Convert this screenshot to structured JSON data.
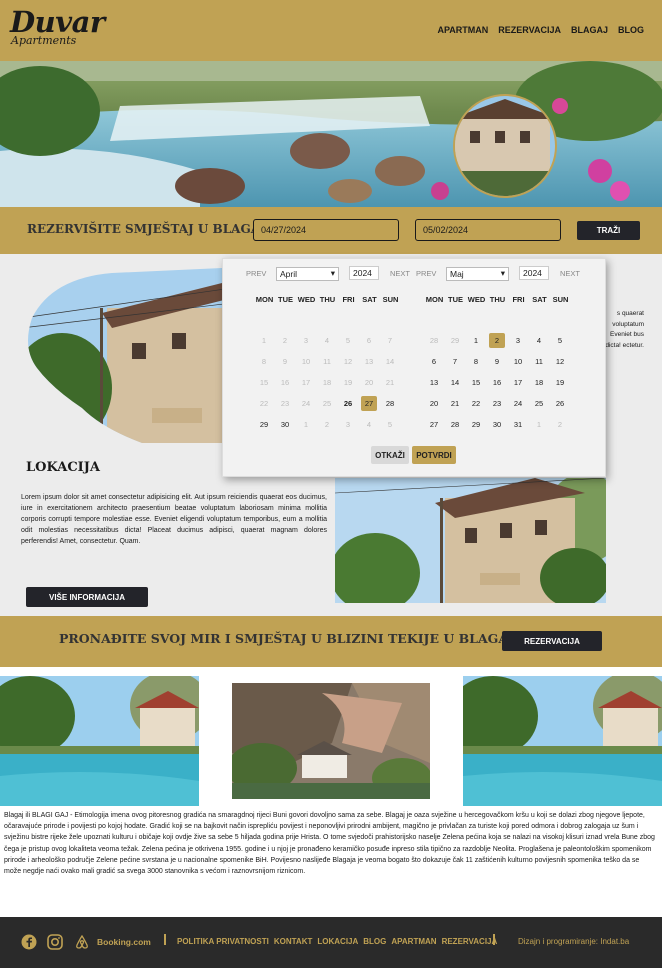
{
  "header": {
    "logo": "Duvar",
    "logo_sub": "Apartments",
    "nav": [
      "APARTMAN",
      "REZERVACIJA",
      "BLAGAJ",
      "BLOG"
    ]
  },
  "booking": {
    "title": "REZERVIŠITE SMJEŠTAJ U BLAGAJU",
    "check_in": "04/27/2024",
    "check_out": "05/02/2024",
    "search_label": "TRAŽI"
  },
  "calendar": {
    "prev_label": "PREV",
    "next_label": "NEXT",
    "weekdays": [
      "MON",
      "TUE",
      "WED",
      "THU",
      "FRI",
      "SAT",
      "SUN"
    ],
    "cancel_label": "OTKAŽI",
    "confirm_label": "POTVRDI",
    "months": [
      {
        "name": "April",
        "year": "2024",
        "weeks": [
          [
            "1",
            "2",
            "3",
            "4",
            "5",
            "6",
            "7"
          ],
          [
            "8",
            "9",
            "10",
            "11",
            "12",
            "13",
            "14"
          ],
          [
            "15",
            "16",
            "17",
            "18",
            "19",
            "20",
            "21"
          ],
          [
            "22",
            "23",
            "24",
            "25",
            "26",
            "27",
            "28"
          ],
          [
            "29",
            "30",
            "1",
            "2",
            "3",
            "4",
            "5"
          ]
        ],
        "style": [
          [
            "o",
            "o",
            "o",
            "o",
            "o",
            "o",
            "o"
          ],
          [
            "o",
            "o",
            "o",
            "o",
            "o",
            "o",
            "o"
          ],
          [
            "o",
            "o",
            "o",
            "o",
            "o",
            "o",
            "o"
          ],
          [
            "o",
            "o",
            "o",
            "o",
            "today",
            "sel",
            "n"
          ],
          [
            "n",
            "n",
            "o",
            "o",
            "o",
            "o",
            "o"
          ]
        ]
      },
      {
        "name": "Maj",
        "year": "2024",
        "weeks": [
          [
            "28",
            "29",
            "1",
            "2",
            "3",
            "4",
            "5"
          ],
          [
            "6",
            "7",
            "8",
            "9",
            "10",
            "11",
            "12"
          ],
          [
            "13",
            "14",
            "15",
            "16",
            "17",
            "18",
            "19"
          ],
          [
            "20",
            "21",
            "22",
            "23",
            "24",
            "25",
            "26"
          ],
          [
            "27",
            "28",
            "29",
            "30",
            "31",
            "1",
            "2"
          ]
        ],
        "style": [
          [
            "o",
            "o",
            "n",
            "sel",
            "n",
            "n",
            "n"
          ],
          [
            "n",
            "n",
            "n",
            "n",
            "n",
            "n",
            "n"
          ],
          [
            "n",
            "n",
            "n",
            "n",
            "n",
            "n",
            "n"
          ],
          [
            "n",
            "n",
            "n",
            "n",
            "n",
            "n",
            "n"
          ],
          [
            "n",
            "n",
            "n",
            "n",
            "n",
            "o",
            "o"
          ]
        ]
      }
    ]
  },
  "location": {
    "title": "LOKACIJA",
    "text": "Lorem ipsum dolor sit amet consectetur adipisicing elit. Aut ipsum reiciendis quaerat eos ducimus, iure in exercitationem architecto praesentium beatae voluptatum laboriosam minima mollitia corporis corrupti tempore molestiae esse. Eveniet eligendi voluptatum temporibus, eum a mollitia odit molestias necessitatibus dicta! Placeat ducimus adipisci, quaerat magnam dolores perferendis! Amet, consectetur. Quam.",
    "more_label": "VIŠE INFORMACIJA",
    "right_text": "s quaerat voluptatum Eveniet bus dicta! ectetur."
  },
  "banner": {
    "title": "PRONAĐITE SVOJ MIR I SMJEŠTAJ U BLIZINI TEKIJE U BLAGAJU",
    "button": "REZERVACIJA"
  },
  "description": "Blagaj ili BLAGI GAJ - Etimologija imena ovog pitoresnog gradića na smaragdnoj rijeci Buni govori dovoljno sama za sebe. Blagaj je oaza svježine u hercegovačkom kršu u koji se dolazi zbog njegove ljepote, očaravajuće prirode i povijesti po kojoj hodate. Gradić koji se na bajkovit način isprepliću povijest i neponovljivi prirodni ambijent, magično je privlačan za turiste koji pored odmora i dobrog zalogaja uz šum i svježinu bistre rijeke žele upoznati kulturu i običaje koji ovdje žive sa sebe 5 hiljada godina prije Hrista. O tome svjedoči prahistorijsko naselje Zelena pećina koja se nalazi na visokoj klisuri iznad vrela Bune zbog čega je pristup ovog lokaliteta veoma težak. Zelena pećina je otkrivena 1955. godine i u njoj je pronađeno keramičko posuđe inpreso stila tipično za razdoblje Neolita. Proglašena je paleontološkim spomenikom prirode i arheološko područje Zelene pećine svrstana je u nacionalne spomenike BiH. Povijesno naslijeđe Blagaja je veoma bogato što dokazuje čak 11 zaštićenih kulturno povijesnih spomenika teško da se može negdje naći ovako mali gradić sa svega 3000 stanovnika s većom i raznovrsnijom riznicom.",
  "footer": {
    "booking": "Booking.com",
    "links": [
      "POLITIKA PRIVATNOSTI",
      "KONTAKT",
      "LOKACIJA",
      "BLOG",
      "APARTMAN",
      "REZERVACIJA"
    ],
    "credit": "Dizajn i programiranje: Indat.ba"
  },
  "colors": {
    "gold": "#c0a254",
    "dark": "#23242a",
    "light_bg": "#ececec"
  }
}
